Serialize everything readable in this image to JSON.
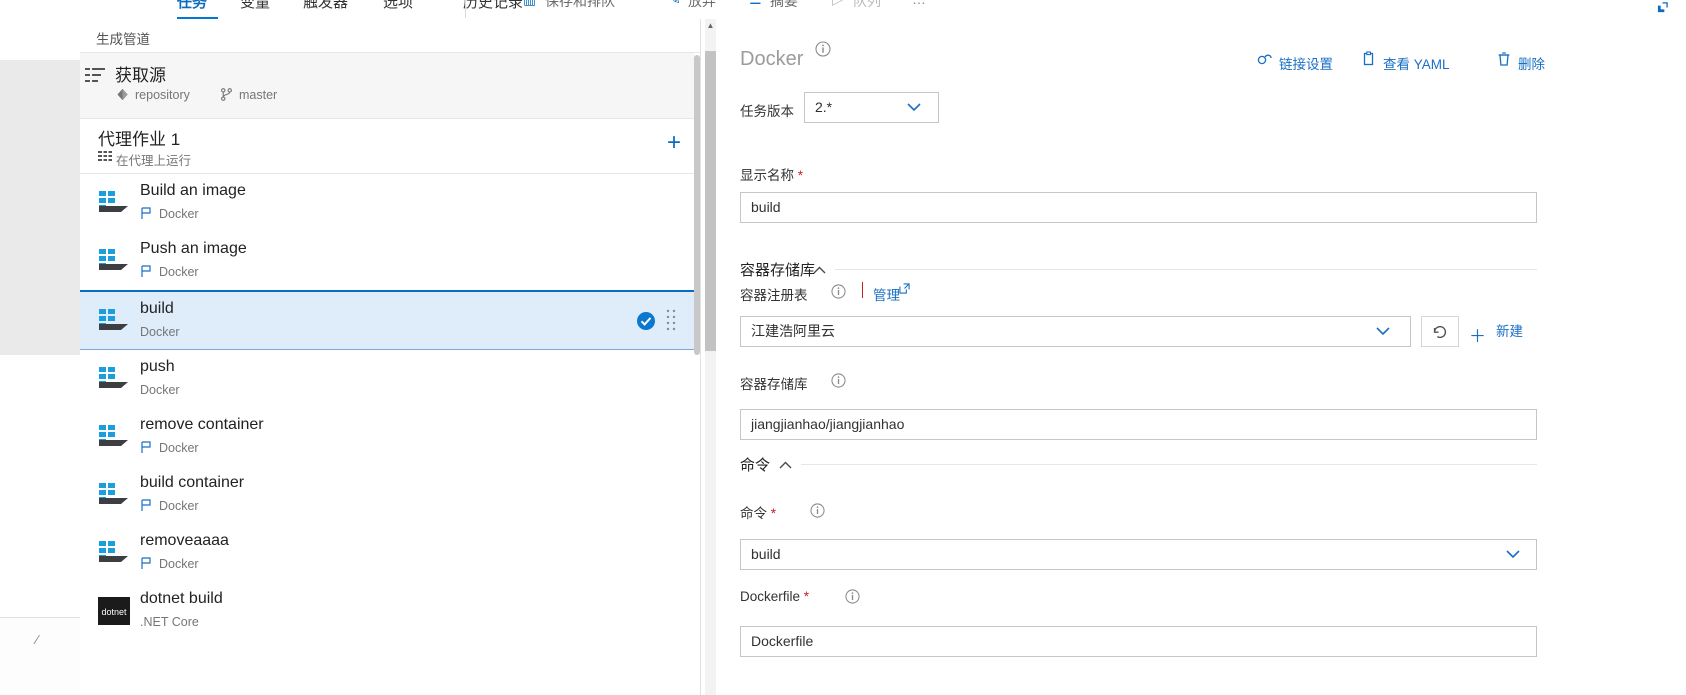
{
  "topbar": {
    "tabs": [
      {
        "label": "任务",
        "active": true
      },
      {
        "label": "变量",
        "active": false
      },
      {
        "label": "触发器",
        "active": false
      },
      {
        "label": "选项",
        "active": false
      },
      {
        "label": "历史记录",
        "active": false
      }
    ],
    "actions": [
      {
        "label": "保存和排队",
        "icon": "save-queue-icon"
      },
      {
        "label": "放弃",
        "icon": "discard-icon"
      },
      {
        "label": "摘要",
        "icon": "summary-icon"
      },
      {
        "label": "队列",
        "icon": "queue-icon"
      },
      {
        "label": "…",
        "icon": "more-icon"
      }
    ],
    "expand_icon": "expand-icon"
  },
  "breadcrumb": {
    "text": "生成管道"
  },
  "pipeline": {
    "sources": {
      "title": "获取源",
      "repository_label": "repository",
      "branch_label": "master",
      "icon": "get-sources-icon",
      "repo_icon": "repo-icon",
      "branch_icon": "branch-icon"
    },
    "job": {
      "title": "代理作业 1",
      "subtitle": "在代理上运行",
      "icon": "agent-icon",
      "add_label": "+"
    },
    "tasks": [
      {
        "name": "Build an image",
        "sub": "Docker",
        "has_flag": true,
        "selected": false
      },
      {
        "name": "Push an image",
        "sub": "Docker",
        "has_flag": true,
        "selected": false
      },
      {
        "name": "build",
        "sub": "Docker",
        "has_flag": false,
        "selected": true
      },
      {
        "name": "push",
        "sub": "Docker",
        "has_flag": false,
        "selected": false
      },
      {
        "name": "remove container",
        "sub": "Docker",
        "has_flag": true,
        "selected": false
      },
      {
        "name": "build container",
        "sub": "Docker",
        "has_flag": true,
        "selected": false
      },
      {
        "name": "removeaaaa",
        "sub": "Docker",
        "has_flag": true,
        "selected": false
      },
      {
        "name": "dotnet build",
        "sub": ".NET Core",
        "has_flag": false,
        "selected": false
      }
    ]
  },
  "details": {
    "title": "Docker",
    "title_info_icon": "info-icon",
    "header_actions": [
      {
        "label": "链接设置",
        "icon": "link-icon"
      },
      {
        "label": "查看 YAML",
        "icon": "clipboard-icon"
      },
      {
        "label": "删除",
        "icon": "trash-icon"
      }
    ],
    "version": {
      "label": "任务版本",
      "value": "2.*"
    },
    "display_name": {
      "label": "显示名称",
      "required": true,
      "value": "build"
    },
    "section_container_repo": {
      "title": "容器存储库",
      "collapsed": false
    },
    "container_registry": {
      "label": "容器注册表",
      "manage_label": "管理",
      "value": "江建浩阿里云",
      "refresh_icon": "refresh-icon",
      "new_label": "新建"
    },
    "container_repository": {
      "label": "容器存储库",
      "value": "jiangjianhao/jiangjianhao"
    },
    "section_command": {
      "title": "命令",
      "collapsed": false
    },
    "command": {
      "label": "命令",
      "required": true,
      "value": "build"
    },
    "dockerfile": {
      "label": "Dockerfile",
      "required": true,
      "value": "Dockerfile"
    }
  },
  "colors": {
    "accent": "#0078d4",
    "link": "#1a6fc4",
    "selected_bg": "#dfecfa",
    "required": "#c32026"
  }
}
